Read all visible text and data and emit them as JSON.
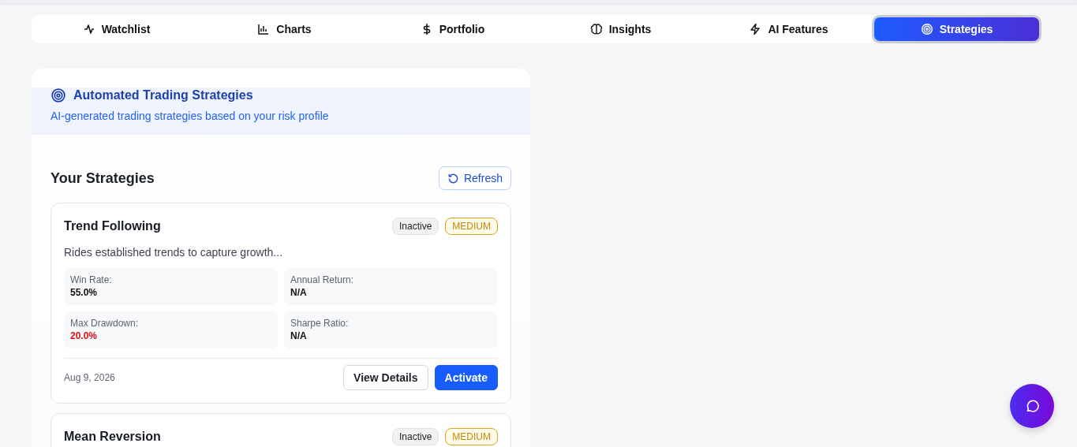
{
  "tabs": [
    {
      "label": "Watchlist",
      "selected": false
    },
    {
      "label": "Charts",
      "selected": false
    },
    {
      "label": "Portfolio",
      "selected": false
    },
    {
      "label": "Insights",
      "selected": false
    },
    {
      "label": "AI Features",
      "selected": false
    },
    {
      "label": "Strategies",
      "selected": true
    }
  ],
  "panel": {
    "title": "Automated Trading Strategies",
    "subtitle": "AI-generated trading strategies based on your risk profile"
  },
  "section": {
    "title": "Your Strategies",
    "refresh_button": "Refresh"
  },
  "strategies": [
    {
      "name": "Trend Following",
      "status": "Inactive",
      "risk": "MEDIUM",
      "description": "Rides established trends to capture growth...",
      "metrics": [
        {
          "label": "Win Rate:",
          "value": "55.0%",
          "kind": "neutral"
        },
        {
          "label": "Annual Return:",
          "value": "N/A",
          "kind": "neutral"
        },
        {
          "label": "Max Drawdown:",
          "value": "20.0%",
          "kind": "negative"
        },
        {
          "label": "Sharpe Ratio:",
          "value": "N/A",
          "kind": "neutral"
        }
      ],
      "date": "Aug 9, 2026",
      "details_button": "View Details",
      "activate_button": "Activate"
    },
    {
      "name": "Mean Reversion",
      "status": "Inactive",
      "risk": "MEDIUM"
    }
  ]
}
